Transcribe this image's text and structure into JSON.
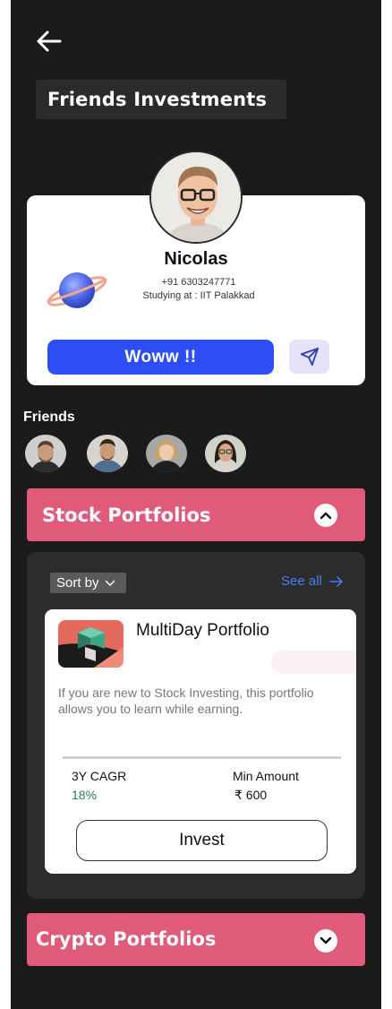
{
  "header": {
    "title": "Friends Investments",
    "back_icon": "arrow-left-icon"
  },
  "profile": {
    "name": "Nicolas",
    "phone": "+91 6303247771",
    "study": "Studying at : IIT Palakkad",
    "cta_label": "Woww !!",
    "send_icon": "send-icon",
    "decor_icon": "planet-icon"
  },
  "friends": {
    "label": "Friends",
    "items": [
      {
        "name": "friend-1"
      },
      {
        "name": "friend-2"
      },
      {
        "name": "friend-3"
      },
      {
        "name": "friend-4"
      }
    ]
  },
  "stock": {
    "title": "Stock Portfolios",
    "expanded": true,
    "sort_label": "Sort by",
    "see_all_label": "See all",
    "card": {
      "name": "MultiDay Portfolio",
      "description": "If you are new to Stock Investing, this portfolio allows you to learn while earning.",
      "cagr_label": "3Y CAGR",
      "cagr_value": "18%",
      "min_label": "Min Amount",
      "min_value": "₹  600",
      "invest_label": "Invest"
    }
  },
  "crypto": {
    "title": "Crypto Portfolios",
    "expanded": false
  },
  "colors": {
    "background": "#1b1b1c",
    "accent_pink": "#e05a79",
    "primary_blue": "#2d4ef5",
    "link_blue": "#4a7bf2",
    "positive_green": "#2f7a5a"
  }
}
